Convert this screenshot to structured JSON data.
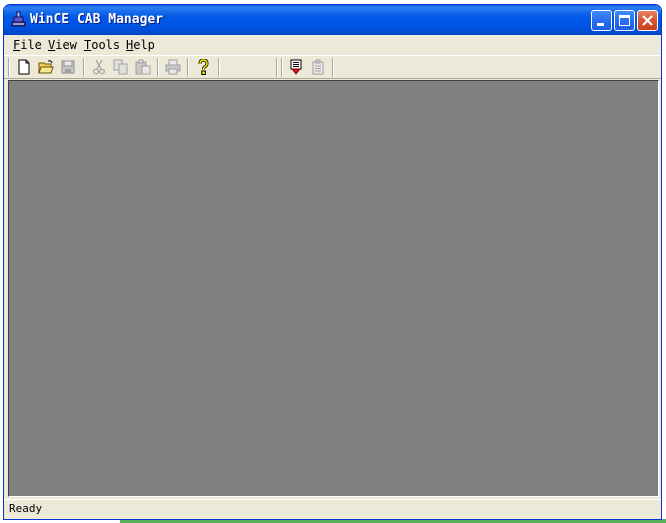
{
  "window": {
    "title": "WinCE CAB Manager",
    "controls": [
      "minimize-icon",
      "maximize-icon",
      "close-icon"
    ]
  },
  "menu": {
    "items": [
      {
        "label": "File",
        "underline": "F",
        "rest": "ile"
      },
      {
        "label": "View",
        "underline": "V",
        "rest": "iew"
      },
      {
        "label": "Tools",
        "underline": "T",
        "rest": "ools"
      },
      {
        "label": "Help",
        "underline": "H",
        "rest": "elp"
      }
    ]
  },
  "toolbar": {
    "buttons": [
      {
        "icon": "new-file-icon",
        "enabled": true
      },
      {
        "icon": "open-folder-icon",
        "enabled": true
      },
      {
        "icon": "save-icon",
        "enabled": false
      },
      {
        "icon": "cut-icon",
        "enabled": false
      },
      {
        "icon": "copy-icon",
        "enabled": false
      },
      {
        "icon": "paste-icon",
        "enabled": false
      },
      {
        "icon": "print-icon",
        "enabled": false
      },
      {
        "icon": "help-icon",
        "enabled": true
      },
      {
        "icon": "install-cab-icon",
        "enabled": true
      },
      {
        "icon": "properties-icon",
        "enabled": false
      }
    ]
  },
  "status": {
    "text": "Ready"
  },
  "colors": {
    "titlebar": "#0054e3",
    "workspace": "#808080",
    "chrome": "#ece9d8",
    "close_button": "#d9542f"
  }
}
